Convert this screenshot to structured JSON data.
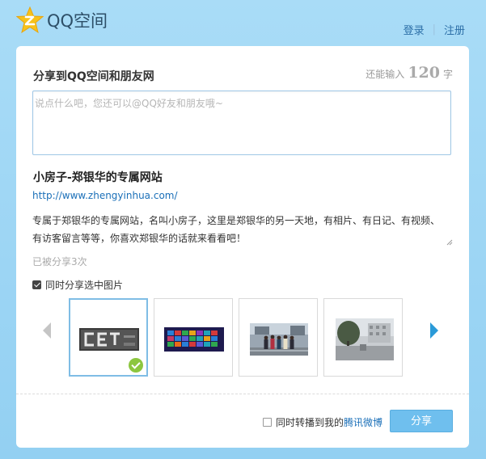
{
  "header": {
    "logo_text": "QQ空间",
    "login_label": "登录",
    "separator": "|",
    "register_label": "注册"
  },
  "share": {
    "title": "分享到QQ空间和朋友网",
    "counter_prefix": "还能输入",
    "counter_value": "120",
    "counter_suffix": "字",
    "comment_placeholder": "说点什么吧，您还可以@QQ好友和朋友哦~"
  },
  "site": {
    "title": "小房子-郑银华的专属网站",
    "url": "http://www.zhengyinhua.com/",
    "description": "专属于郑银华的专属网站，名叫小房子，这里是郑银华的另一天地，有相片、有日记、有视频、有访客留言等等，你喜欢郑银华的话就来看看吧！",
    "shared_count_text": "已被分享3次"
  },
  "images": {
    "sync_label": "同时分享选中图片",
    "sync_checked": true,
    "thumbnails": [
      {
        "name": "cet-logo",
        "selected": true
      },
      {
        "name": "windows8-tiles",
        "selected": false
      },
      {
        "name": "group-photo",
        "selected": false
      },
      {
        "name": "campus-photo",
        "selected": false
      }
    ]
  },
  "footer": {
    "repost_label": "同时转播到我的",
    "repost_link": "腾讯微博",
    "repost_checked": false,
    "share_button": "分享"
  },
  "colors": {
    "background": "#a9dcf7",
    "link": "#1a6fb8",
    "share_button": "#6fbfee",
    "selected_border": "#7fbde5",
    "check_badge": "#8cc63f"
  }
}
